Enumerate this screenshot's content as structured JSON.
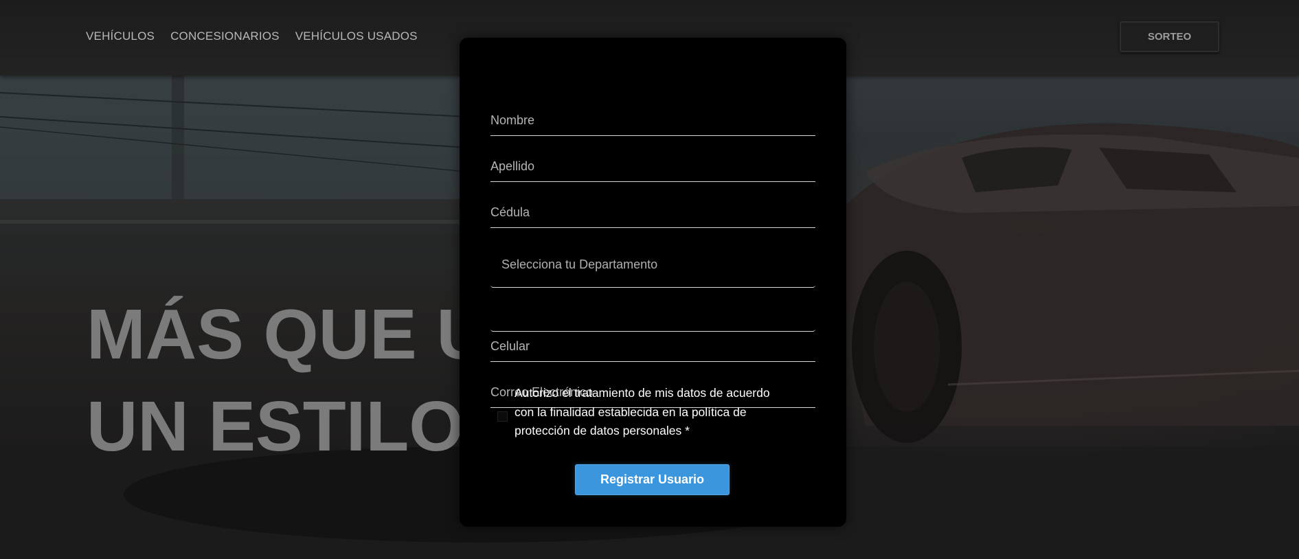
{
  "nav": {
    "items": [
      "VEHÍCULOS",
      "CONCESIONARIOS",
      "VEHÍCULOS USADOS"
    ],
    "sorteo_label": "SORTEO"
  },
  "hero": {
    "line1": "MÁS QUE UN AUTO",
    "line2": "UN ESTILO"
  },
  "form": {
    "nombre_label": "Nombre",
    "apellido_label": "Apellido",
    "cedula_label": "Cédula",
    "departamento_placeholder": "Selecciona tu Departamento",
    "celular_label": "Celular",
    "correo_label": "Correo Electrónico",
    "consent_text": "Autorizo el tratamiento de mis datos de acuerdo con la finalidad establecida en la política de protección de datos personales *",
    "submit_label": "Registrar Usuario"
  },
  "colors": {
    "accent": "#3b96dd",
    "card_bg": "#000000",
    "hero_text": "#7b7b7b"
  }
}
